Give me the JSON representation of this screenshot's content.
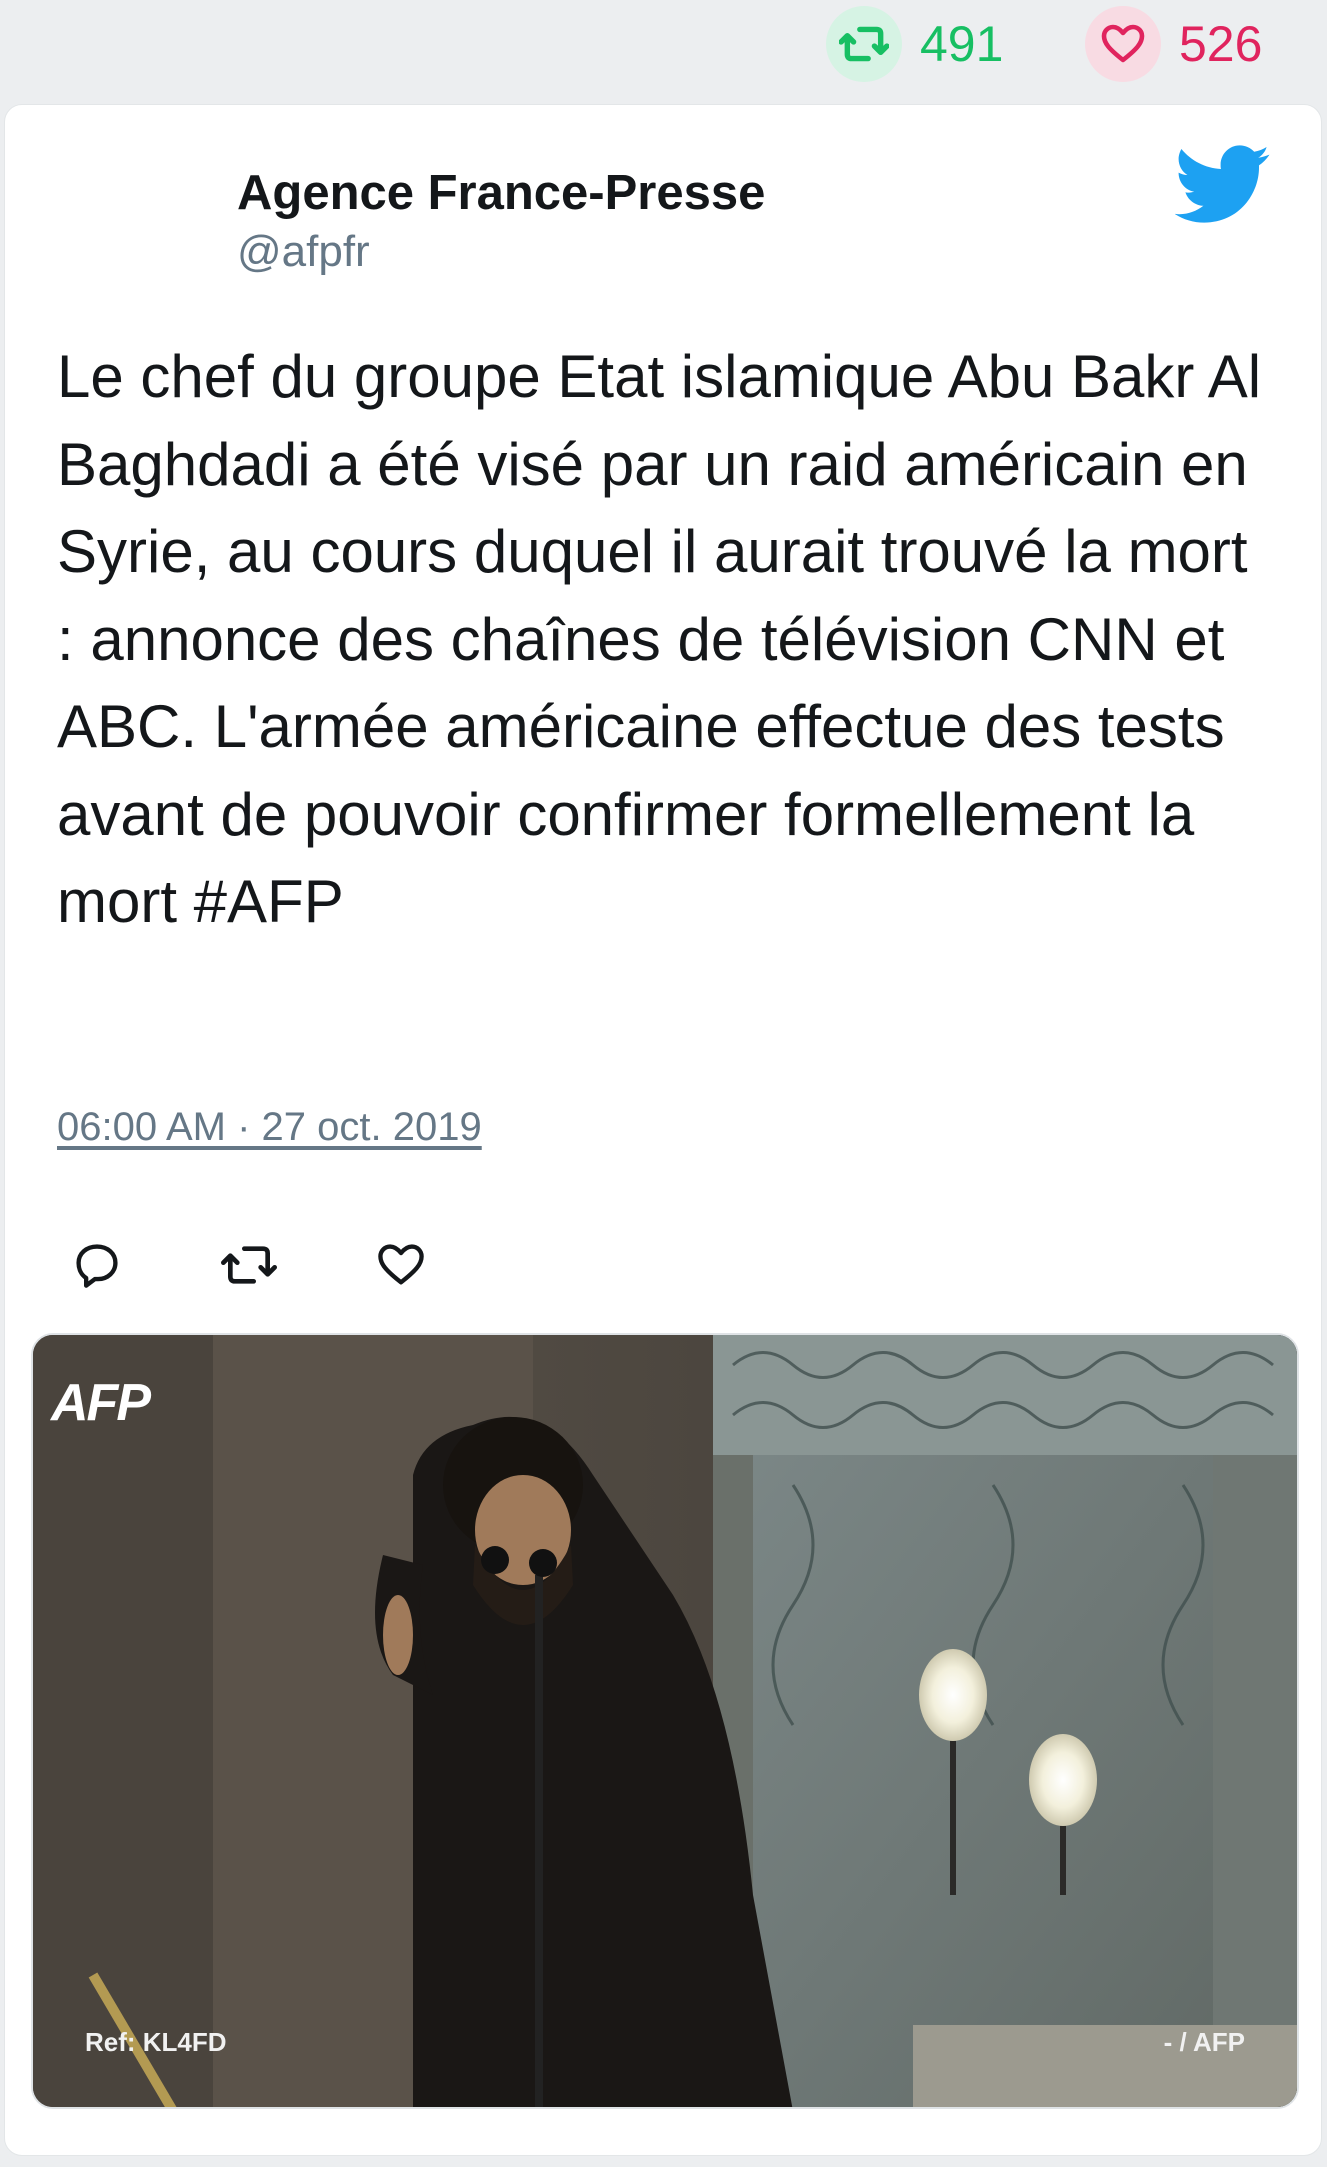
{
  "stats": {
    "retweets": "491",
    "likes": "526",
    "retweet_icon": "retweet-icon",
    "like_icon": "heart-icon"
  },
  "tweet": {
    "author_name": "Agence France-Presse",
    "author_handle": "@afpfr",
    "brand_icon": "twitter-bird-icon",
    "text": "Le chef du groupe Etat islamique Abu Bakr Al Baghdadi a été visé par un raid américain en Syrie, au cours duquel il aurait trouvé la mort : annonce des chaînes de télévision CNN et ABC. L'armée américaine effectue des tests avant de pouvoir confirmer formellement la mort #AFP",
    "timestamp": "06:00 AM · 27 oct. 2019",
    "actions": [
      "reply-icon",
      "retweet-icon",
      "heart-icon"
    ]
  },
  "media": {
    "logo": "AFP",
    "ref": "Ref: KL4FD",
    "credit": "- / AFP"
  },
  "colors": {
    "retweet": "#17bf63",
    "like": "#e0245e",
    "twitter_blue": "#1da1f2",
    "text": "#14171a",
    "muted": "#657786"
  }
}
